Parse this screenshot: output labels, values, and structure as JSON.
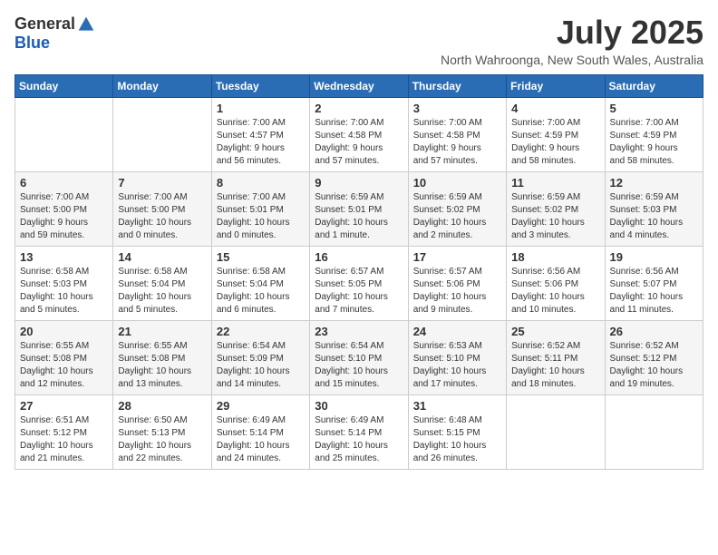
{
  "header": {
    "logo_general": "General",
    "logo_blue": "Blue",
    "month_title": "July 2025",
    "location": "North Wahroonga, New South Wales, Australia"
  },
  "weekdays": [
    "Sunday",
    "Monday",
    "Tuesday",
    "Wednesday",
    "Thursday",
    "Friday",
    "Saturday"
  ],
  "weeks": [
    [
      {
        "day": "",
        "info": ""
      },
      {
        "day": "",
        "info": ""
      },
      {
        "day": "1",
        "info": "Sunrise: 7:00 AM\nSunset: 4:57 PM\nDaylight: 9 hours\nand 56 minutes."
      },
      {
        "day": "2",
        "info": "Sunrise: 7:00 AM\nSunset: 4:58 PM\nDaylight: 9 hours\nand 57 minutes."
      },
      {
        "day": "3",
        "info": "Sunrise: 7:00 AM\nSunset: 4:58 PM\nDaylight: 9 hours\nand 57 minutes."
      },
      {
        "day": "4",
        "info": "Sunrise: 7:00 AM\nSunset: 4:59 PM\nDaylight: 9 hours\nand 58 minutes."
      },
      {
        "day": "5",
        "info": "Sunrise: 7:00 AM\nSunset: 4:59 PM\nDaylight: 9 hours\nand 58 minutes."
      }
    ],
    [
      {
        "day": "6",
        "info": "Sunrise: 7:00 AM\nSunset: 5:00 PM\nDaylight: 9 hours\nand 59 minutes."
      },
      {
        "day": "7",
        "info": "Sunrise: 7:00 AM\nSunset: 5:00 PM\nDaylight: 10 hours\nand 0 minutes."
      },
      {
        "day": "8",
        "info": "Sunrise: 7:00 AM\nSunset: 5:01 PM\nDaylight: 10 hours\nand 0 minutes."
      },
      {
        "day": "9",
        "info": "Sunrise: 6:59 AM\nSunset: 5:01 PM\nDaylight: 10 hours\nand 1 minute."
      },
      {
        "day": "10",
        "info": "Sunrise: 6:59 AM\nSunset: 5:02 PM\nDaylight: 10 hours\nand 2 minutes."
      },
      {
        "day": "11",
        "info": "Sunrise: 6:59 AM\nSunset: 5:02 PM\nDaylight: 10 hours\nand 3 minutes."
      },
      {
        "day": "12",
        "info": "Sunrise: 6:59 AM\nSunset: 5:03 PM\nDaylight: 10 hours\nand 4 minutes."
      }
    ],
    [
      {
        "day": "13",
        "info": "Sunrise: 6:58 AM\nSunset: 5:03 PM\nDaylight: 10 hours\nand 5 minutes."
      },
      {
        "day": "14",
        "info": "Sunrise: 6:58 AM\nSunset: 5:04 PM\nDaylight: 10 hours\nand 5 minutes."
      },
      {
        "day": "15",
        "info": "Sunrise: 6:58 AM\nSunset: 5:04 PM\nDaylight: 10 hours\nand 6 minutes."
      },
      {
        "day": "16",
        "info": "Sunrise: 6:57 AM\nSunset: 5:05 PM\nDaylight: 10 hours\nand 7 minutes."
      },
      {
        "day": "17",
        "info": "Sunrise: 6:57 AM\nSunset: 5:06 PM\nDaylight: 10 hours\nand 9 minutes."
      },
      {
        "day": "18",
        "info": "Sunrise: 6:56 AM\nSunset: 5:06 PM\nDaylight: 10 hours\nand 10 minutes."
      },
      {
        "day": "19",
        "info": "Sunrise: 6:56 AM\nSunset: 5:07 PM\nDaylight: 10 hours\nand 11 minutes."
      }
    ],
    [
      {
        "day": "20",
        "info": "Sunrise: 6:55 AM\nSunset: 5:08 PM\nDaylight: 10 hours\nand 12 minutes."
      },
      {
        "day": "21",
        "info": "Sunrise: 6:55 AM\nSunset: 5:08 PM\nDaylight: 10 hours\nand 13 minutes."
      },
      {
        "day": "22",
        "info": "Sunrise: 6:54 AM\nSunset: 5:09 PM\nDaylight: 10 hours\nand 14 minutes."
      },
      {
        "day": "23",
        "info": "Sunrise: 6:54 AM\nSunset: 5:10 PM\nDaylight: 10 hours\nand 15 minutes."
      },
      {
        "day": "24",
        "info": "Sunrise: 6:53 AM\nSunset: 5:10 PM\nDaylight: 10 hours\nand 17 minutes."
      },
      {
        "day": "25",
        "info": "Sunrise: 6:52 AM\nSunset: 5:11 PM\nDaylight: 10 hours\nand 18 minutes."
      },
      {
        "day": "26",
        "info": "Sunrise: 6:52 AM\nSunset: 5:12 PM\nDaylight: 10 hours\nand 19 minutes."
      }
    ],
    [
      {
        "day": "27",
        "info": "Sunrise: 6:51 AM\nSunset: 5:12 PM\nDaylight: 10 hours\nand 21 minutes."
      },
      {
        "day": "28",
        "info": "Sunrise: 6:50 AM\nSunset: 5:13 PM\nDaylight: 10 hours\nand 22 minutes."
      },
      {
        "day": "29",
        "info": "Sunrise: 6:49 AM\nSunset: 5:14 PM\nDaylight: 10 hours\nand 24 minutes."
      },
      {
        "day": "30",
        "info": "Sunrise: 6:49 AM\nSunset: 5:14 PM\nDaylight: 10 hours\nand 25 minutes."
      },
      {
        "day": "31",
        "info": "Sunrise: 6:48 AM\nSunset: 5:15 PM\nDaylight: 10 hours\nand 26 minutes."
      },
      {
        "day": "",
        "info": ""
      },
      {
        "day": "",
        "info": ""
      }
    ]
  ]
}
